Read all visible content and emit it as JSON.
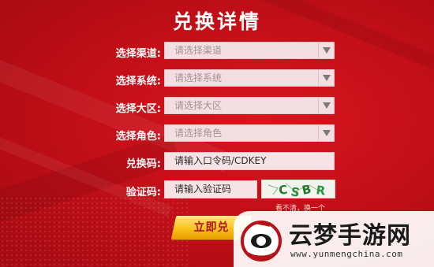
{
  "title": "兑换详情",
  "fields": {
    "channel": {
      "label": "选择渠道:",
      "placeholder": "请选择渠道"
    },
    "system": {
      "label": "选择系统:",
      "placeholder": "请选择系统"
    },
    "region": {
      "label": "选择大区:",
      "placeholder": "请选择大区"
    },
    "role": {
      "label": "选择角色:",
      "placeholder": "请选择角色"
    },
    "code": {
      "label": "兑换码:",
      "placeholder": "请输入口令码/CDKEY"
    },
    "captcha": {
      "label": "验证码:",
      "placeholder": "请输入验证码"
    }
  },
  "captcha_text": "看不清，换一个",
  "submit_label": "立即兑",
  "watermark": {
    "name": "云梦手游网",
    "url": "www.yunmengchina.com"
  },
  "colors": {
    "background": "#c8101a",
    "field_bg": "#f3dfe1",
    "button_gold": "#f8c21c"
  }
}
